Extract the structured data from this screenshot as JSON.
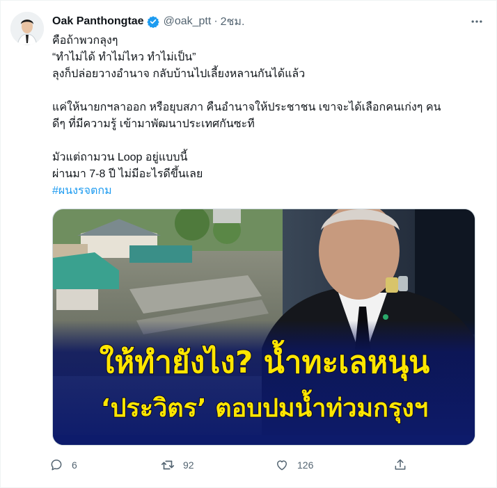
{
  "tweet": {
    "author": {
      "name": "Oak Panthongtae",
      "handle": "@oak_ptt",
      "verified": true,
      "avatar_icon": "profile-photo"
    },
    "separator": "·",
    "time": "2ชม.",
    "more_icon": "more-horizontal-icon",
    "text": {
      "line1": "คือถ้าพวกลุงๆ",
      "line2": "“ทำไม่ได้ ทำไม่ไหว ทำไม่เป็น”",
      "line3": "ลุงก็ปล่อยวางอำนาจ กลับบ้านไปเลี้ยงหลานกันได้แล้ว",
      "line4": "แค่ให้นายกฯลาออก หรือยุบสภา คืนอำนาจให้ประชาชน เขาจะได้เลือกคนเก่งๆ คน",
      "line5": "ดีๆ ที่มีความรู้ เข้ามาพัฒนาประเทศกันซะที",
      "line6": "มัวแต่ถามวน Loop อยู่แบบนี้",
      "line7": "ผ่านมา 7-8 ปี ไม่มีอะไรดีขึ้นเลย",
      "hashtag": "#ผนงรจตกม"
    },
    "media": {
      "headline1": "ให้ทำยังไง? น้ำทะเลหนุน",
      "headline2": "‘ประวิตร’ ตอบปมน้ำท่วมกรุงฯ"
    },
    "actions": {
      "reply_count": "6",
      "retweet_count": "92",
      "like_count": "126"
    }
  },
  "colors": {
    "text": "#0f1419",
    "secondary": "#536471",
    "link": "#1d9bf0",
    "headline_yellow": "#ffe600",
    "headline_bg": "#0d1b6b"
  }
}
